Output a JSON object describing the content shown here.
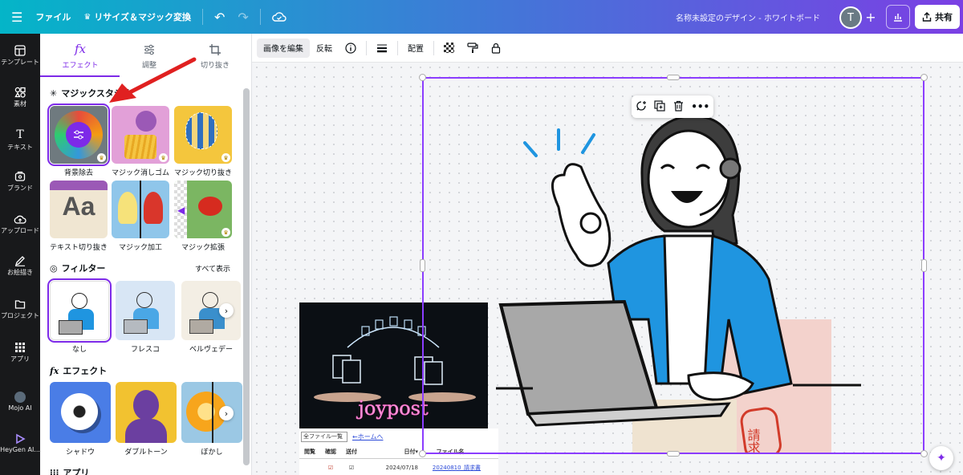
{
  "topbar": {
    "file_label": "ファイル",
    "resize_label": "リサイズ＆マジック変換",
    "doc_title": "名称未設定のデザイン - ホワイトボード",
    "avatar_initial": "T",
    "share_label": "共有"
  },
  "rail": {
    "items": [
      {
        "label": "テンプレート",
        "icon": "template-icon"
      },
      {
        "label": "素材",
        "icon": "elements-icon"
      },
      {
        "label": "テキスト",
        "icon": "text-icon"
      },
      {
        "label": "ブランド",
        "icon": "brand-icon"
      },
      {
        "label": "アップロード",
        "icon": "upload-icon"
      },
      {
        "label": "お絵描き",
        "icon": "draw-icon"
      },
      {
        "label": "プロジェクト",
        "icon": "folder-icon"
      },
      {
        "label": "アプリ",
        "icon": "apps-icon"
      },
      {
        "label": "Mojo AI",
        "icon": "mojo-icon"
      },
      {
        "label": "HeyGen AI...",
        "icon": "heygen-icon"
      }
    ]
  },
  "panel": {
    "tabs": [
      {
        "label": "エフェクト",
        "icon": "fx-icon",
        "active": true
      },
      {
        "label": "調整",
        "icon": "sliders-icon",
        "active": false
      },
      {
        "label": "切り抜き",
        "icon": "crop-icon",
        "active": false
      }
    ],
    "magic_studio_title": "マジックスタジオ",
    "magic_tools": [
      {
        "label": "背景除去"
      },
      {
        "label": "マジック消しゴム"
      },
      {
        "label": "マジック切り抜き"
      },
      {
        "label": "テキスト切り抜き"
      },
      {
        "label": "マジック加工"
      },
      {
        "label": "マジック拡張"
      }
    ],
    "filters_title": "フィルター",
    "see_all": "すべて表示",
    "filters": [
      {
        "label": "なし"
      },
      {
        "label": "フレスコ"
      },
      {
        "label": "ベルヴェデー"
      }
    ],
    "effects_title": "エフェクト",
    "effects": [
      {
        "label": "シャドウ"
      },
      {
        "label": "ダブルトーン"
      },
      {
        "label": "ぼかし"
      }
    ],
    "apps_title": "アプリ"
  },
  "toolbar": {
    "edit_image": "画像を編集",
    "flip": "反転",
    "position": "配置"
  },
  "canvas": {
    "joypost_text": "joypost",
    "table": {
      "dropdown": "全ファイル一覧",
      "home_link": "←ホームへ",
      "headers": [
        "閲覧",
        "確認",
        "送付",
        "日付▾",
        "ファイル名"
      ],
      "row": {
        "date": "2024/07/18",
        "file": "20240810_請求書"
      }
    },
    "stamp_text": "請求書"
  },
  "colors": {
    "accent": "#7d2ae8",
    "topbar_start": "#04b5c8",
    "topbar_end": "#7b3fe4",
    "rail_bg": "#18191b"
  }
}
